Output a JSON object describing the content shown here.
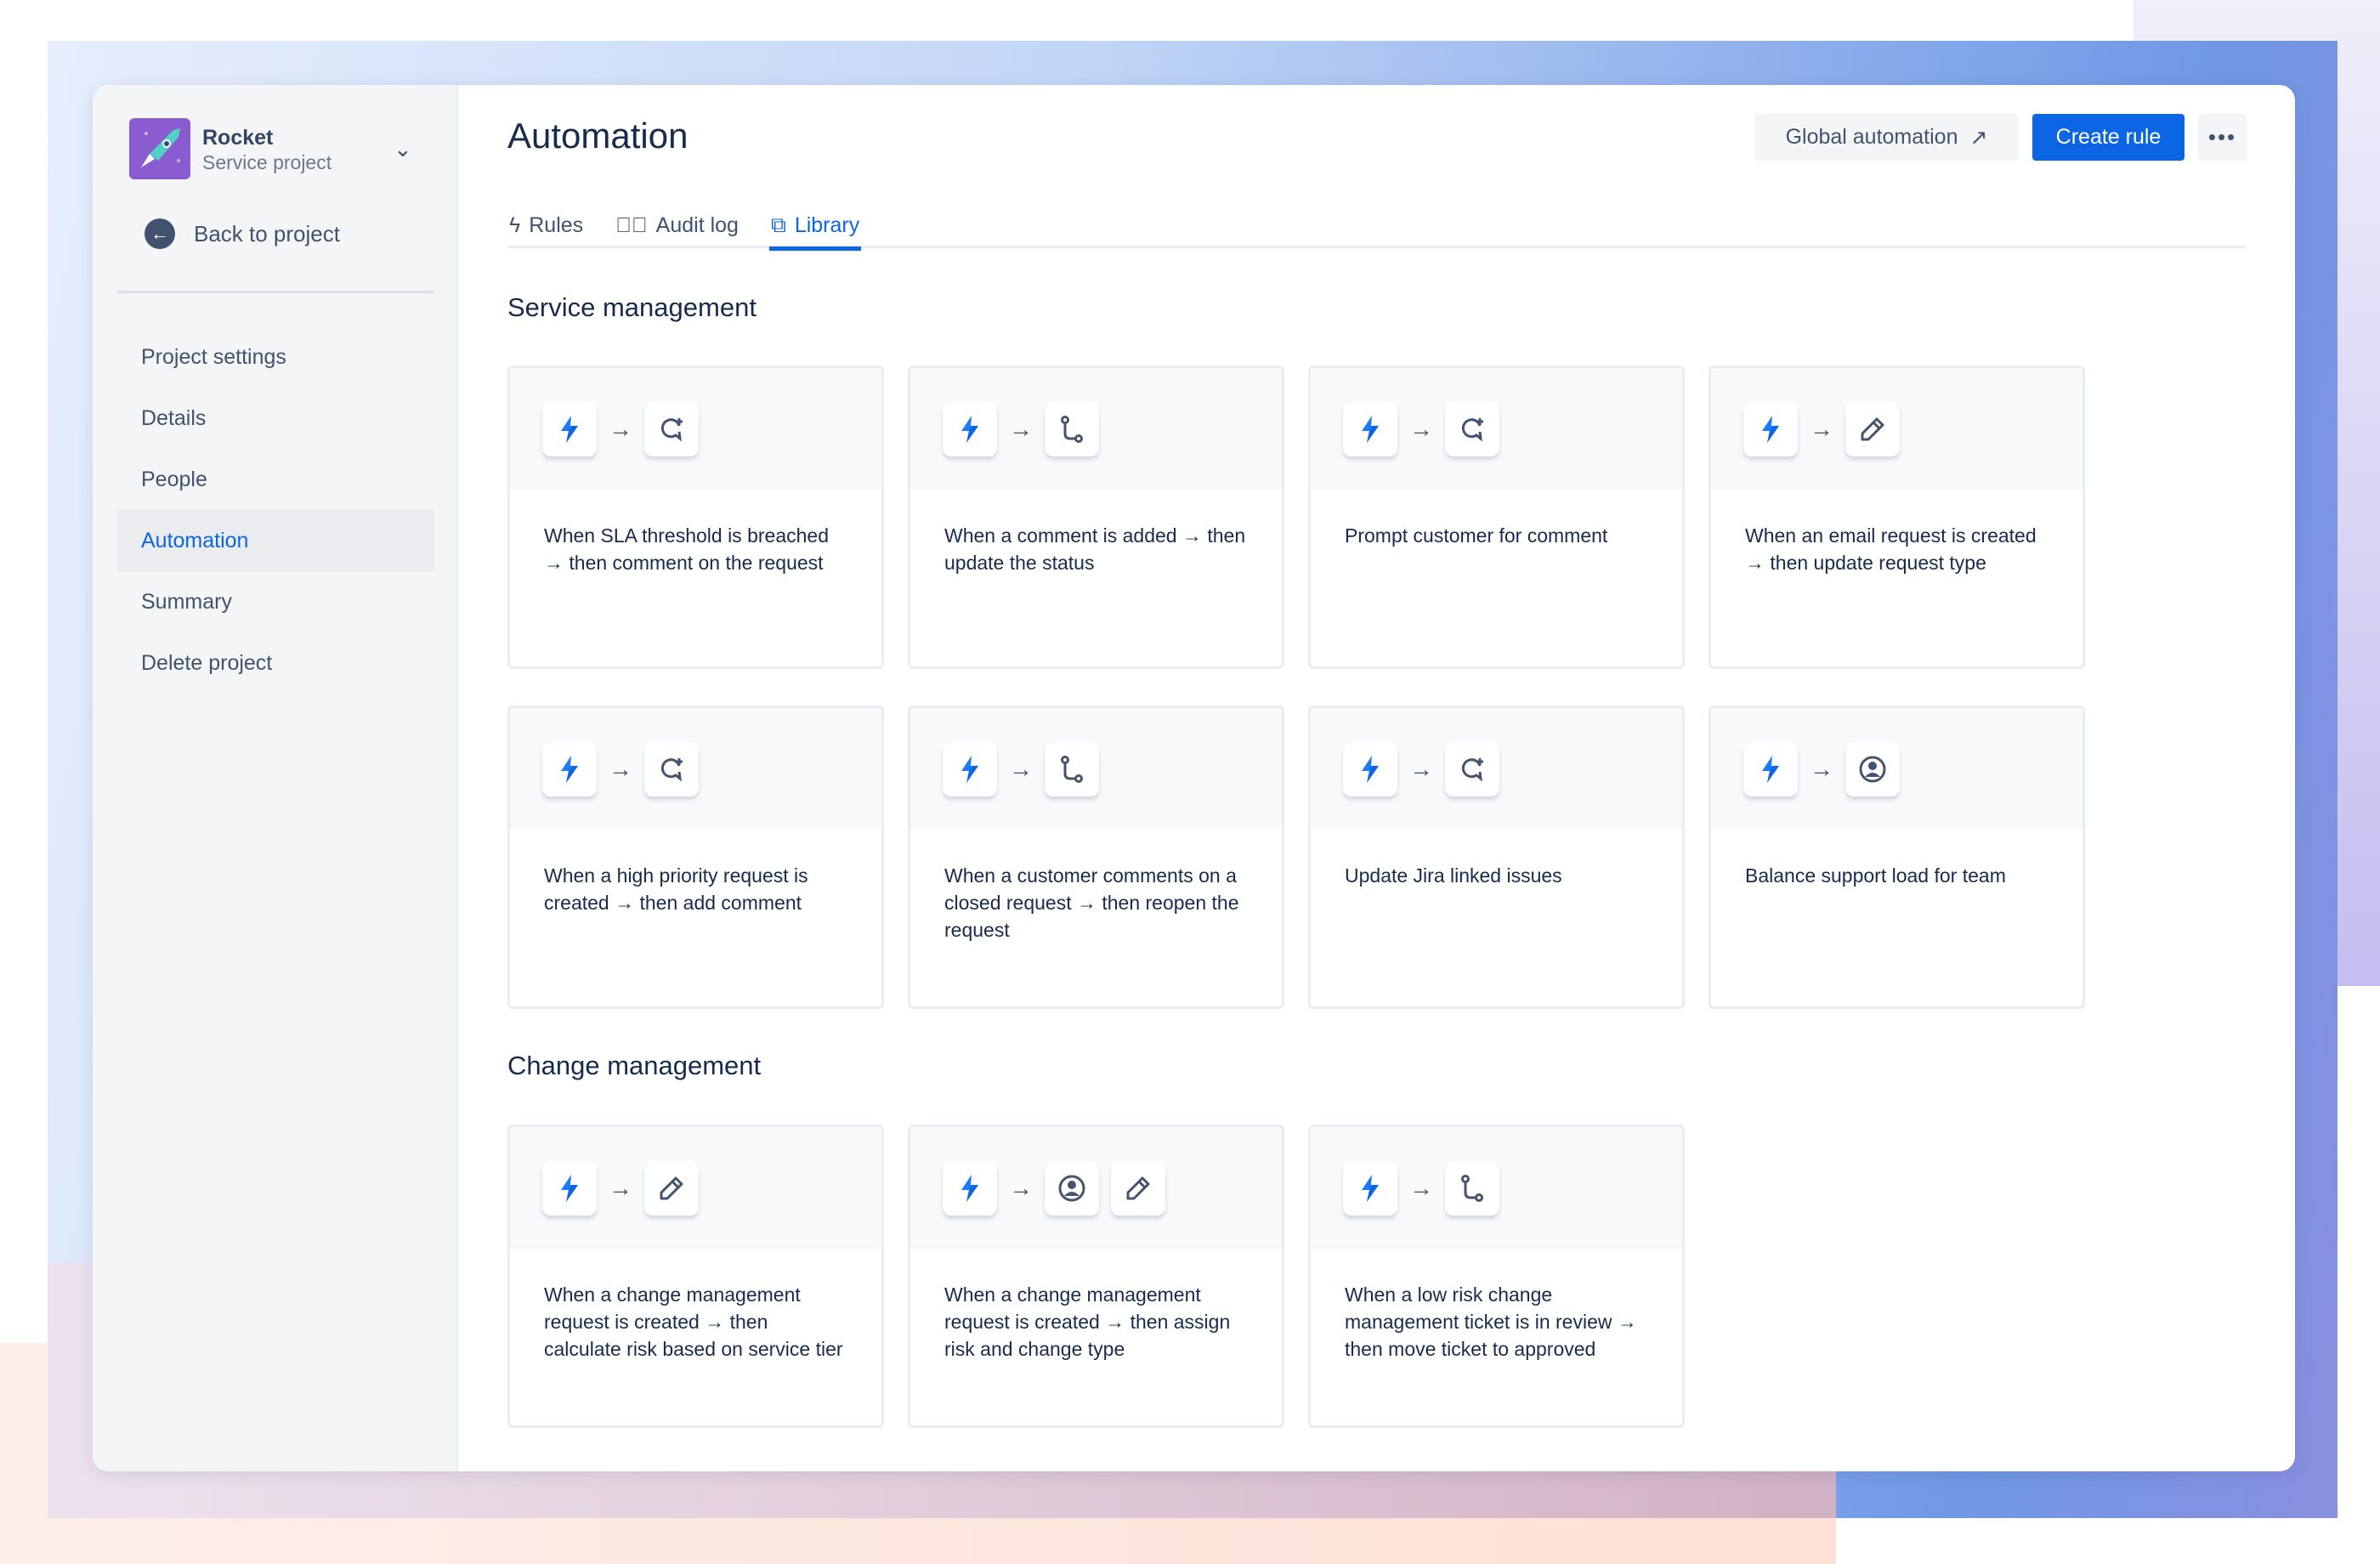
{
  "project": {
    "name": "Rocket",
    "type": "Service project",
    "back_label": "Back to project"
  },
  "sidebar": {
    "items": [
      {
        "label": "Project settings"
      },
      {
        "label": "Details"
      },
      {
        "label": "People"
      },
      {
        "label": "Automation",
        "active": true
      },
      {
        "label": "Summary"
      },
      {
        "label": "Delete project"
      }
    ]
  },
  "header": {
    "title": "Automation",
    "global_label": "Global automation",
    "create_label": "Create rule",
    "more_label": "•••"
  },
  "tabs": [
    {
      "label": "Rules",
      "icon": "lightning-icon"
    },
    {
      "label": "Audit log",
      "icon": "check-circle-icon"
    },
    {
      "label": "Library",
      "icon": "copy-icon",
      "active": true
    }
  ],
  "accent": "#0C66E4",
  "sections": [
    {
      "title": "Service management",
      "rules": [
        {
          "text": "When SLA threshold is breached → then comment on the request",
          "icons": [
            "comment"
          ]
        },
        {
          "text": "When a comment is added → then update the status",
          "icons": [
            "branch"
          ]
        },
        {
          "text": "Prompt customer for comment",
          "icons": [
            "comment"
          ]
        },
        {
          "text": "When an email request is created → then update request type",
          "icons": [
            "pencil"
          ]
        },
        {
          "text": "When a high priority request is created → then add comment",
          "icons": [
            "comment"
          ]
        },
        {
          "text": "When a customer comments on a closed request → then reopen the request",
          "icons": [
            "branch"
          ]
        },
        {
          "text": "Update Jira linked issues",
          "icons": [
            "comment"
          ]
        },
        {
          "text": "Balance support load for team",
          "icons": [
            "user"
          ]
        }
      ]
    },
    {
      "title": "Change management",
      "rules": [
        {
          "text": "When a change management request is created → then calculate risk based on service tier",
          "icons": [
            "pencil"
          ]
        },
        {
          "text": "When a change management request is created → then assign risk and change type",
          "icons": [
            "user",
            "pencil"
          ]
        },
        {
          "text": "When a low risk change management ticket is in review → then move ticket to approved",
          "icons": [
            "branch"
          ]
        }
      ]
    }
  ]
}
